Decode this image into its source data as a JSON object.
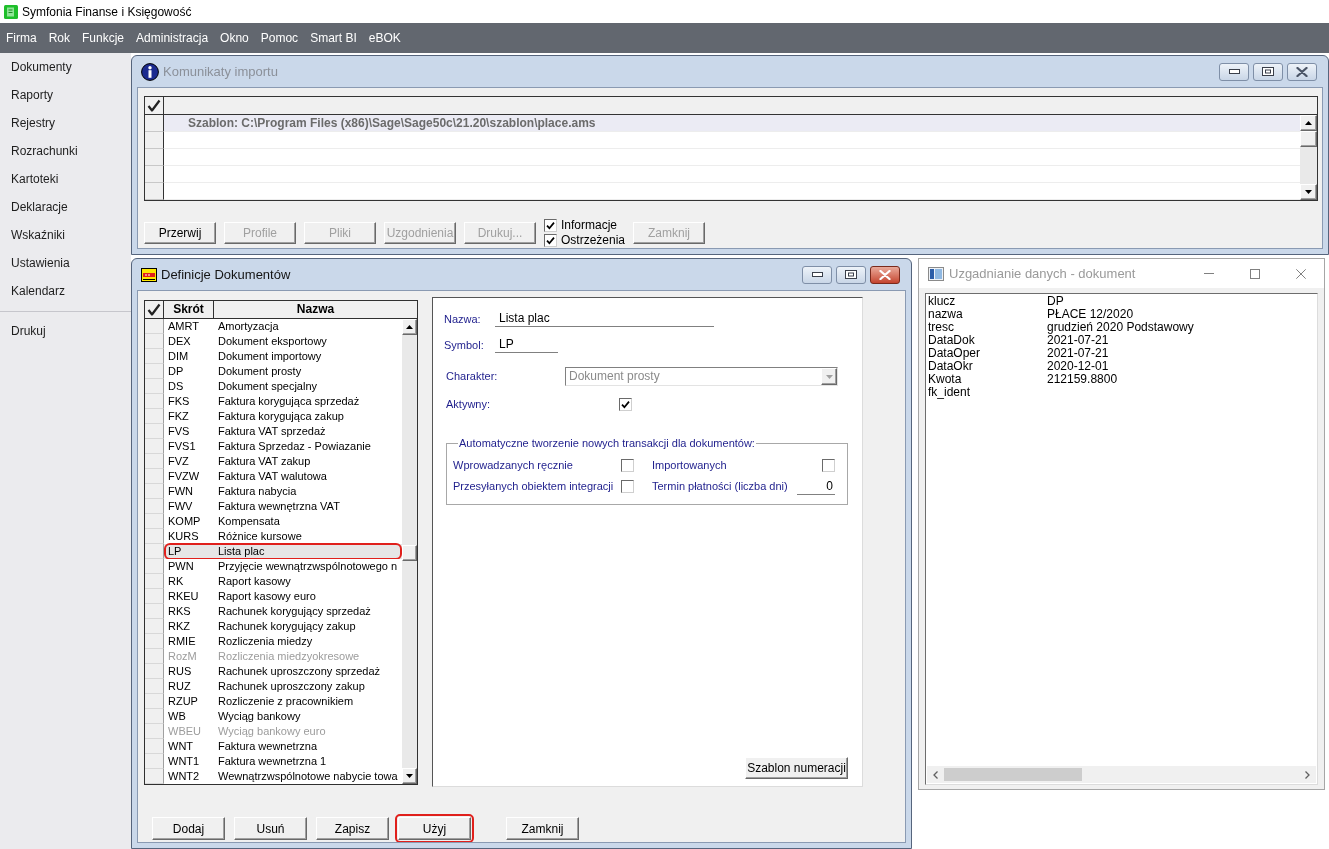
{
  "app_title": "Symfonia Finanse i Księgowość",
  "menu": [
    "Firma",
    "Rok",
    "Funkcje",
    "Administracja",
    "Okno",
    "Pomoc",
    "Smart BI",
    "eBOK"
  ],
  "sidebar": {
    "items": [
      "Dokumenty",
      "Raporty",
      "Rejestry",
      "Rozrachunki",
      "Kartoteki",
      "Deklaracje",
      "Wskaźniki",
      "Ustawienia",
      "Kalendarz"
    ],
    "bottom_items": [
      "Drukuj"
    ]
  },
  "import_messages_window": {
    "title": "Komunikaty importu",
    "active": false,
    "messages": [
      {
        "text": "Szablon: C:\\Program Files (x86)\\Sage\\Sage50c\\21.20\\szablon\\place.ams",
        "selected": true
      }
    ],
    "buttons": [
      {
        "label": "Przerwij",
        "disabled": false
      },
      {
        "label": "Profile",
        "disabled": true
      },
      {
        "label": "Pliki",
        "disabled": true
      },
      {
        "label": "Uzgodnienia",
        "disabled": true
      },
      {
        "label": "Drukuj...",
        "disabled": true
      }
    ],
    "filters": [
      {
        "label": "Informacje",
        "checked": true
      },
      {
        "label": "Ostrzeżenia",
        "checked": true
      }
    ],
    "close_button": {
      "label": "Zamknij",
      "disabled": true
    }
  },
  "document_definitions_window": {
    "title": "Definicje Dokumentów",
    "active": true,
    "columns": [
      "Skrót",
      "Nazwa"
    ],
    "rows": [
      {
        "code": "AMRT",
        "name": "Amortyzacja",
        "selected": false,
        "disabled": false,
        "circled": false
      },
      {
        "code": "DEX",
        "name": "Dokument eksportowy",
        "selected": false,
        "disabled": false,
        "circled": false
      },
      {
        "code": "DIM",
        "name": "Dokument importowy",
        "selected": false,
        "disabled": false,
        "circled": false
      },
      {
        "code": "DP",
        "name": "Dokument prosty",
        "selected": false,
        "disabled": false,
        "circled": false
      },
      {
        "code": "DS",
        "name": "Dokument specjalny",
        "selected": false,
        "disabled": false,
        "circled": false
      },
      {
        "code": "FKS",
        "name": "Faktura korygująca sprzedaż",
        "selected": false,
        "disabled": false,
        "circled": false
      },
      {
        "code": "FKZ",
        "name": "Faktura korygująca zakup",
        "selected": false,
        "disabled": false,
        "circled": false
      },
      {
        "code": "FVS",
        "name": "Faktura VAT sprzedaż",
        "selected": false,
        "disabled": false,
        "circled": false
      },
      {
        "code": "FVS1",
        "name": "Faktura Sprzedaz - Powiazanie",
        "selected": false,
        "disabled": false,
        "circled": false
      },
      {
        "code": "FVZ",
        "name": "Faktura VAT zakup",
        "selected": false,
        "disabled": false,
        "circled": false
      },
      {
        "code": "FVZW",
        "name": "Faktura VAT walutowa",
        "selected": false,
        "disabled": false,
        "circled": false
      },
      {
        "code": "FWN",
        "name": "Faktura nabycia",
        "selected": false,
        "disabled": false,
        "circled": false
      },
      {
        "code": "FWV",
        "name": "Faktura wewnętrzna VAT",
        "selected": false,
        "disabled": false,
        "circled": false
      },
      {
        "code": "KOMP",
        "name": "Kompensata",
        "selected": false,
        "disabled": false,
        "circled": false
      },
      {
        "code": "KURS",
        "name": "Różnice kursowe",
        "selected": false,
        "disabled": false,
        "circled": false
      },
      {
        "code": "LP",
        "name": "Lista plac",
        "selected": true,
        "disabled": false,
        "circled": true
      },
      {
        "code": "PWN",
        "name": "Przyjęcie wewnątrzwspólnotowego n",
        "selected": false,
        "disabled": false,
        "circled": false
      },
      {
        "code": "RK",
        "name": "Raport kasowy",
        "selected": false,
        "disabled": false,
        "circled": false
      },
      {
        "code": "RKEU",
        "name": "Raport kasowy euro",
        "selected": false,
        "disabled": false,
        "circled": false
      },
      {
        "code": "RKS",
        "name": "Rachunek korygujący sprzedaż",
        "selected": false,
        "disabled": false,
        "circled": false
      },
      {
        "code": "RKZ",
        "name": "Rachunek korygujący zakup",
        "selected": false,
        "disabled": false,
        "circled": false
      },
      {
        "code": "RMIE",
        "name": "Rozliczenia miedzy",
        "selected": false,
        "disabled": false,
        "circled": false
      },
      {
        "code": "RozM",
        "name": "Rozliczenia miedzyokresowe",
        "selected": false,
        "disabled": true,
        "circled": false
      },
      {
        "code": "RUS",
        "name": "Rachunek uproszczony sprzedaż",
        "selected": false,
        "disabled": false,
        "circled": false
      },
      {
        "code": "RUZ",
        "name": "Rachunek uproszczony zakup",
        "selected": false,
        "disabled": false,
        "circled": false
      },
      {
        "code": "RZUP",
        "name": "Rozliczenie z pracownikiem",
        "selected": false,
        "disabled": false,
        "circled": false
      },
      {
        "code": "WB",
        "name": "Wyciąg bankowy",
        "selected": false,
        "disabled": false,
        "circled": false
      },
      {
        "code": "WBEU",
        "name": "Wyciąg bankowy euro",
        "selected": false,
        "disabled": true,
        "circled": false
      },
      {
        "code": "WNT",
        "name": "Faktura wewnetrzna",
        "selected": false,
        "disabled": false,
        "circled": false
      },
      {
        "code": "WNT1",
        "name": "Faktura wewnetrzna 1",
        "selected": false,
        "disabled": false,
        "circled": false
      },
      {
        "code": "WNT2",
        "name": "Wewnątrzwspólnotowe nabycie towa",
        "selected": false,
        "disabled": false,
        "circled": false
      }
    ],
    "form": {
      "name": {
        "label": "Nazwa:",
        "value": "Lista plac"
      },
      "symbol": {
        "label": "Symbol:",
        "value": "LP"
      },
      "character": {
        "label": "Charakter:",
        "value": "Dokument prosty",
        "disabled": true
      },
      "active": {
        "label": "Aktywny:",
        "checked": true
      },
      "auto_transactions": {
        "legend": "Automatyczne tworzenie nowych transakcji dla dokumentów:",
        "manual": {
          "label": "Wprowadzanych ręcznie",
          "checked": false
        },
        "imported": {
          "label": "Importowanych",
          "checked": false
        },
        "integration": {
          "label": "Przesyłanych obiektem integracji",
          "checked": false
        },
        "payment_term": {
          "label": "Termin płatności (liczba dni)",
          "value": "0"
        }
      },
      "numbering_button": "Szablon numeracji"
    },
    "buttons": [
      {
        "label": "Dodaj",
        "circled": false
      },
      {
        "label": "Usuń",
        "circled": false
      },
      {
        "label": "Zapisz",
        "circled": false
      },
      {
        "label": "Użyj",
        "circled": true
      }
    ],
    "close_button": {
      "label": "Zamknij",
      "circled": false
    }
  },
  "reconciliation_window": {
    "title": "Uzgadnianie danych - dokument",
    "active": false,
    "fields": [
      {
        "key": "klucz",
        "value": "DP"
      },
      {
        "key": "nazwa",
        "value": "PŁACE 12/2020"
      },
      {
        "key": "tresc",
        "value": "grudzień 2020 Podstawowy"
      },
      {
        "key": "DataDok",
        "value": "2021-07-21"
      },
      {
        "key": "DataOper",
        "value": "2021-07-21"
      },
      {
        "key": "DataOkr",
        "value": "2020-12-01"
      },
      {
        "key": "Kwota",
        "value": "212159.8800"
      },
      {
        "key": "fk_ident"
      }
    ]
  }
}
